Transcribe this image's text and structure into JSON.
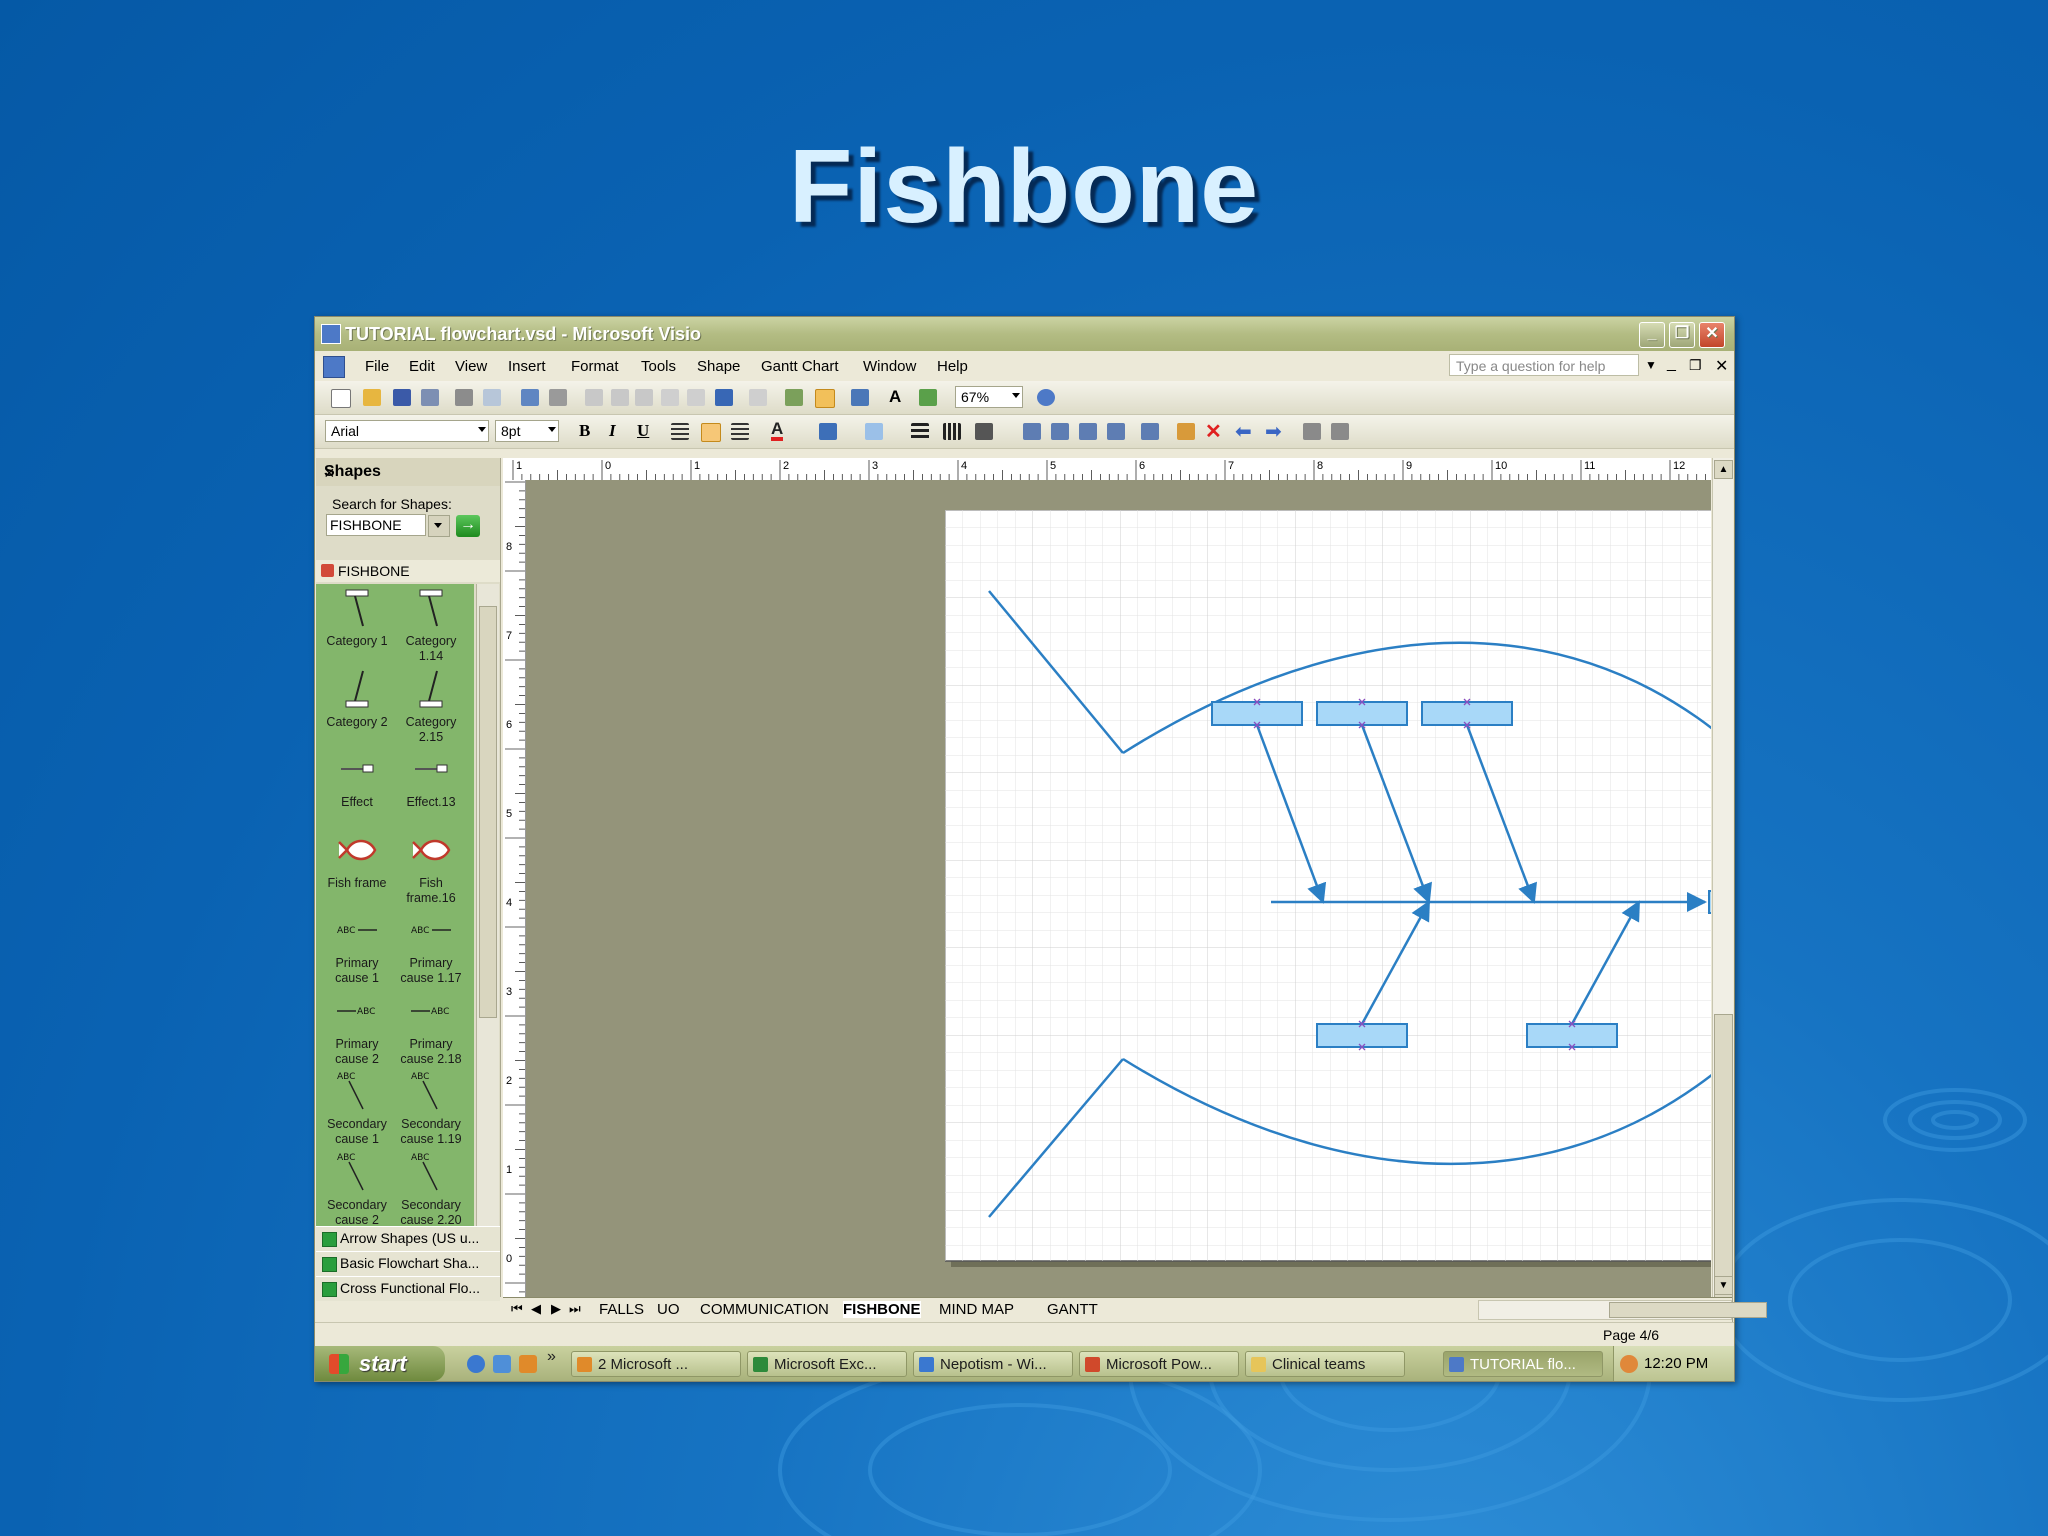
{
  "slide": {
    "title": "Fishbone"
  },
  "window": {
    "title": "TUTORIAL flowchart.vsd - Microsoft Visio",
    "menu": [
      "File",
      "Edit",
      "View",
      "Insert",
      "Format",
      "Tools",
      "Shape",
      "Gantt Chart",
      "Window",
      "Help"
    ],
    "help_placeholder": "Type a question for help",
    "zoom": "67%",
    "font_name": "Arial",
    "font_size": "8pt",
    "bold_label": "B",
    "italic_label": "I",
    "underline_label": "U",
    "font_color_label": "A",
    "text_tool_label": "A"
  },
  "shapes_panel": {
    "title": "Shapes",
    "close": "×",
    "search_label": "Search for Shapes:",
    "search_value": "FISHBONE",
    "go": "→",
    "stencil_name": "FISHBONE",
    "items": [
      {
        "label": "Category 1",
        "icon": "category-1-icon"
      },
      {
        "label": "Category 1.14",
        "icon": "category-1-icon"
      },
      {
        "label": "Category 2",
        "icon": "category-2-icon"
      },
      {
        "label": "Category 2.15",
        "icon": "category-2-icon"
      },
      {
        "label": "Effect",
        "icon": "effect-icon"
      },
      {
        "label": "Effect.13",
        "icon": "effect-icon"
      },
      {
        "label": "Fish frame",
        "icon": "fish-frame-icon"
      },
      {
        "label": "Fish frame.16",
        "icon": "fish-frame-icon"
      },
      {
        "label": "Primary cause 1",
        "icon": "primary-cause-1-icon"
      },
      {
        "label": "Primary cause 1.17",
        "icon": "primary-cause-1-icon"
      },
      {
        "label": "Primary cause 2",
        "icon": "primary-cause-2-icon"
      },
      {
        "label": "Primary cause 2.18",
        "icon": "primary-cause-2-icon"
      },
      {
        "label": "Secondary cause 1",
        "icon": "secondary-cause-1-icon"
      },
      {
        "label": "Secondary cause 1.19",
        "icon": "secondary-cause-1-icon"
      },
      {
        "label": "Secondary cause 2",
        "icon": "secondary-cause-2-icon"
      },
      {
        "label": "Secondary cause 2.20",
        "icon": "secondary-cause-2-icon"
      }
    ],
    "icon_text": "ABC",
    "other_stencils": [
      "Arrow Shapes (US u...",
      "Basic Flowchart Sha...",
      "Cross Functional Flo..."
    ]
  },
  "ruler": {
    "top_labels": [
      "1",
      "0",
      "1",
      "2",
      "3",
      "4",
      "5",
      "6",
      "7",
      "8",
      "9",
      "10",
      "11",
      "12"
    ],
    "left_labels": [
      "8",
      "7",
      "6",
      "5",
      "4",
      "3",
      "2",
      "1",
      "0"
    ]
  },
  "page_tabs": [
    "FALLS",
    "UO",
    "COMMUNICATION",
    "FISHBONE",
    "MIND MAP",
    "GANTT"
  ],
  "active_tab": "FISHBONE",
  "status": {
    "page": "Page 4/6"
  },
  "taskbar": {
    "start": "start",
    "tasks": [
      {
        "label": "2 Microsoft ...",
        "color": "#e08a2a"
      },
      {
        "label": "Microsoft Exc...",
        "color": "#2d8a3a"
      },
      {
        "label": "Nepotism - Wi...",
        "color": "#3a78d0"
      },
      {
        "label": "Microsoft Pow...",
        "color": "#d0492b"
      },
      {
        "label": "Clinical teams",
        "color": "#e6c55a"
      },
      {
        "label": "TUTORIAL flo...",
        "color": "#4d79c7"
      }
    ],
    "quick_more": "»",
    "clock": "12:20 PM"
  },
  "colors": {
    "slide_bg": "#0a62b2",
    "title_text": "#d8f0ff",
    "diagram_line": "#2b7fc4",
    "box_fill": "#a8d8f8"
  }
}
